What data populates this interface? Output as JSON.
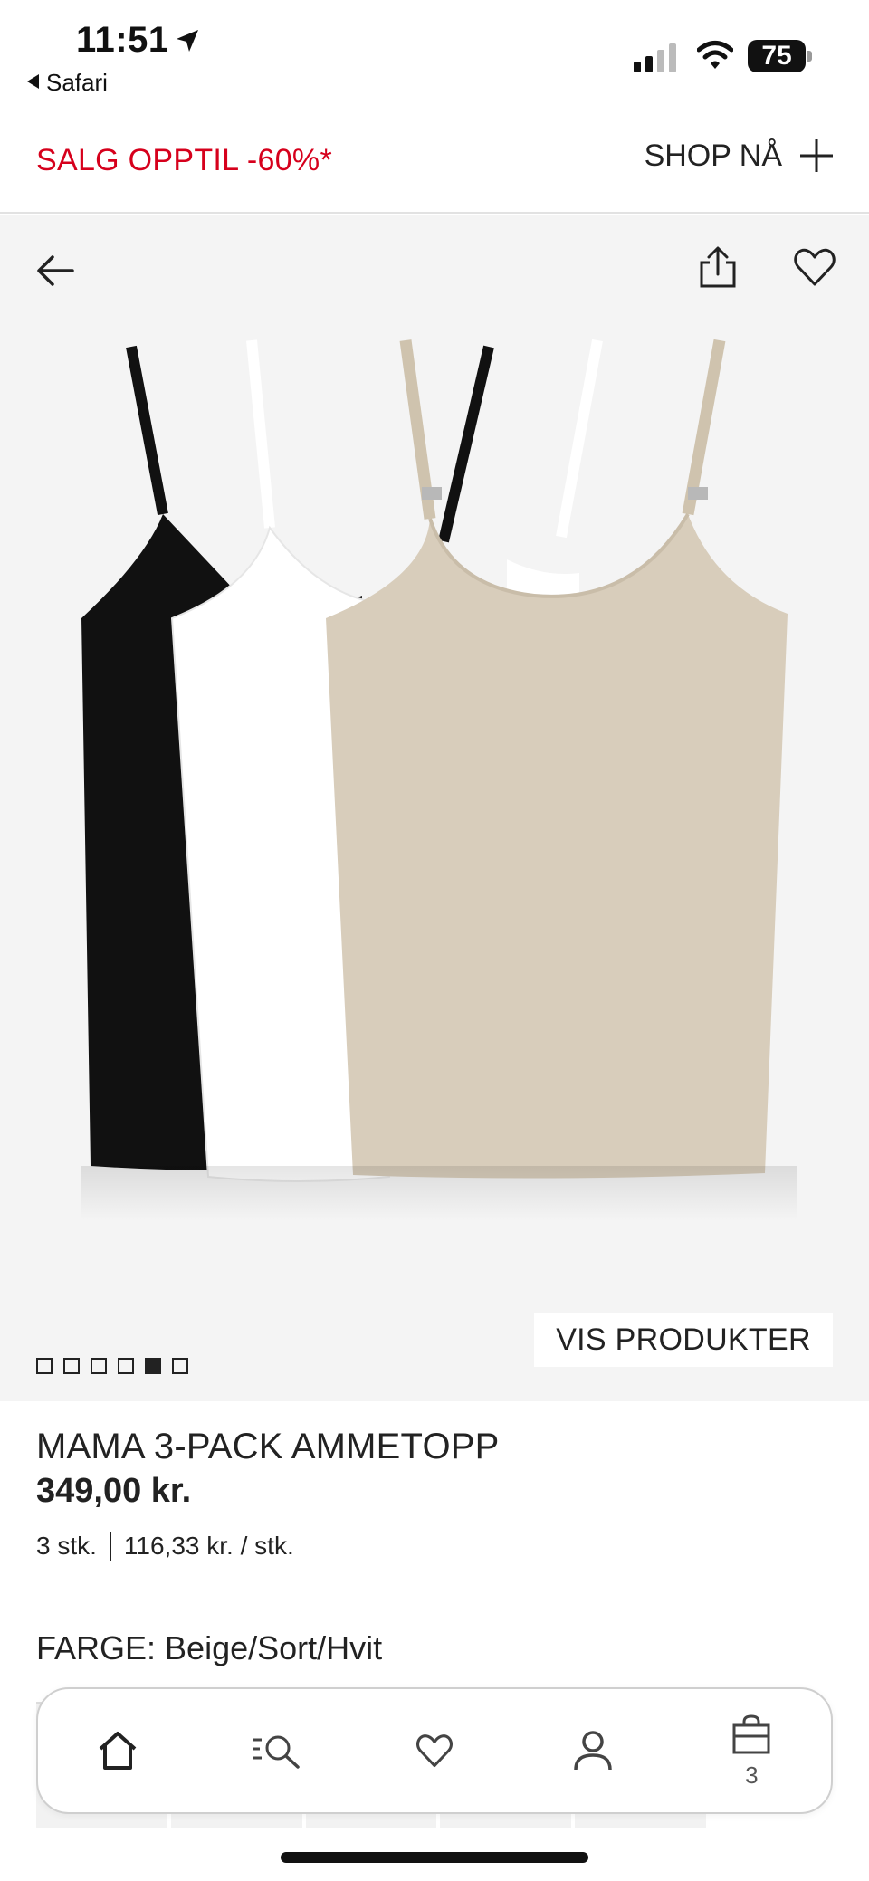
{
  "status_bar": {
    "time": "11:51",
    "back_app": "Safari",
    "battery": "75"
  },
  "promo": {
    "sale_text": "SALG OPPTIL -60%*",
    "shop_now": "SHOP NÅ"
  },
  "gallery": {
    "image_count": 6,
    "active_index": 4,
    "view_products": "VIS PRODUKTER",
    "garment_colors": [
      "#111111",
      "#ffffff",
      "#d8cdbb"
    ]
  },
  "product": {
    "title": "MAMA 3-PACK AMMETOPP",
    "price": "349,00 kr.",
    "quantity": "3 stk.",
    "unit_price": "116,33 kr. / stk.",
    "color_label": "FARGE: Beige/Sort/Hvit"
  },
  "bottom_nav": {
    "bag_count": "3"
  },
  "colors": {
    "sale_red": "#d6001c",
    "text": "#222222",
    "gallery_bg": "#f4f4f4"
  }
}
